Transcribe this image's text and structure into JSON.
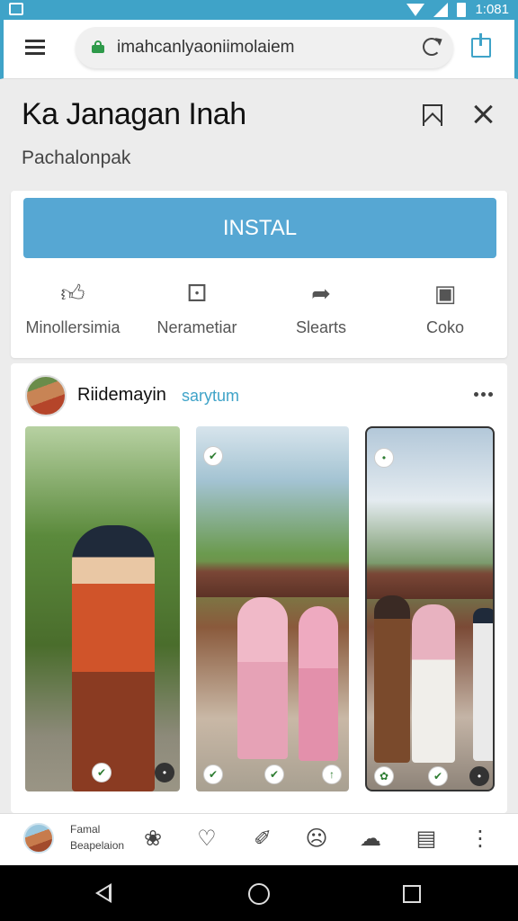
{
  "status_bar": {
    "time": "1:081",
    "icons": [
      "app-icon",
      "wifi-icon",
      "signal-icon",
      "battery-icon"
    ]
  },
  "browser": {
    "menu_icon": "hamburger-icon",
    "url": "imahcanlyaoniimolaiem",
    "lock_color": "#2e9a4a",
    "reload_icon": "reload-icon",
    "share_icon": "share-icon"
  },
  "header": {
    "title": "Ka Janagan Inah",
    "subtitle": "Pachalonpak",
    "bookmark_icon": "bookmark-icon",
    "close_icon": "close-icon"
  },
  "install": {
    "label": "INSTAL",
    "color": "#56a7d3",
    "actions": [
      {
        "icon": "thumbs-up-icon",
        "label": "Minollersimia"
      },
      {
        "icon": "shirt-icon",
        "label": "Nerametiar"
      },
      {
        "icon": "share-arrow-icon",
        "label": "Slearts"
      },
      {
        "icon": "camera-icon",
        "label": "Coko"
      }
    ]
  },
  "post": {
    "name": "Riidemayin",
    "handle": "sarytum",
    "more_icon": "more-icon",
    "images": [
      "photo-1",
      "photo-2",
      "photo-3"
    ]
  },
  "bottom_bar": {
    "label1": "Famal",
    "label2": "Beapelaion",
    "icons": [
      "flower-icon",
      "heart-icon",
      "pin-icon",
      "sad-face-icon",
      "chat-bubble-icon",
      "image-gallery-icon",
      "more-vertical-icon"
    ]
  },
  "nav": {
    "icons": [
      "back-icon",
      "home-icon",
      "recents-icon"
    ]
  }
}
